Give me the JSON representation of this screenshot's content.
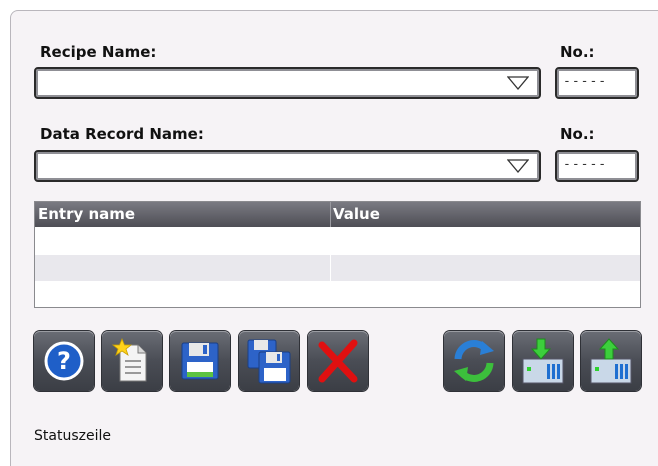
{
  "recipe": {
    "label": "Recipe Name:",
    "value": "",
    "number_label": "No.:",
    "number_value": "-----"
  },
  "record": {
    "label": "Data Record Name:",
    "value": "",
    "number_label": "No.:",
    "number_value": "-----"
  },
  "table": {
    "columns": [
      "Entry name",
      "Value"
    ],
    "rows": [
      [
        "",
        ""
      ],
      [
        "",
        ""
      ],
      [
        "",
        ""
      ]
    ]
  },
  "toolbar": {
    "buttons": [
      {
        "name": "help",
        "icon": "help-icon"
      },
      {
        "name": "new",
        "icon": "new-document-icon"
      },
      {
        "name": "save",
        "icon": "save-icon"
      },
      {
        "name": "save-as",
        "icon": "save-as-icon"
      },
      {
        "name": "delete",
        "icon": "delete-icon"
      },
      {
        "name": "synchronize",
        "icon": "synchronize-icon"
      },
      {
        "name": "read-from-plc",
        "icon": "read-from-plc-icon"
      },
      {
        "name": "write-to-plc",
        "icon": "write-to-plc-icon"
      }
    ]
  },
  "status": {
    "text": "Statuszeile"
  },
  "colors": {
    "panel_bg": "#f6f3f6",
    "header_bg": "#55555c",
    "button_bg": "#4a4d55",
    "help_blue": "#1f5fc8",
    "delete_red": "#e01010"
  }
}
